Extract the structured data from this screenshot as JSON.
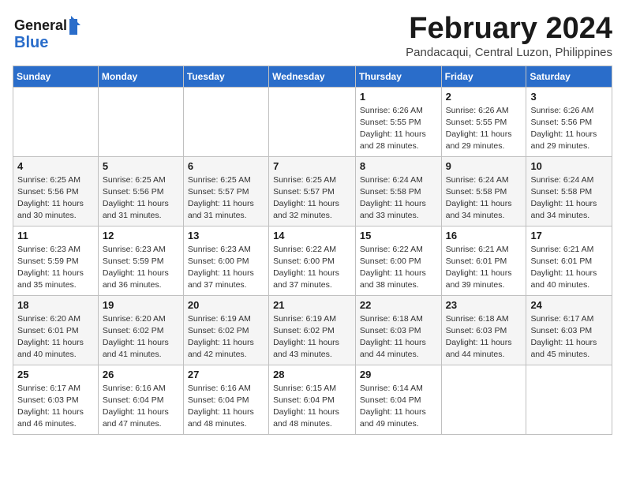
{
  "header": {
    "logo_line1": "General",
    "logo_line2": "Blue",
    "title": "February 2024",
    "subtitle": "Pandacaqui, Central Luzon, Philippines"
  },
  "weekdays": [
    "Sunday",
    "Monday",
    "Tuesday",
    "Wednesday",
    "Thursday",
    "Friday",
    "Saturday"
  ],
  "weeks": [
    [
      {
        "day": "",
        "info": ""
      },
      {
        "day": "",
        "info": ""
      },
      {
        "day": "",
        "info": ""
      },
      {
        "day": "",
        "info": ""
      },
      {
        "day": "1",
        "info": "Sunrise: 6:26 AM\nSunset: 5:55 PM\nDaylight: 11 hours\nand 28 minutes."
      },
      {
        "day": "2",
        "info": "Sunrise: 6:26 AM\nSunset: 5:55 PM\nDaylight: 11 hours\nand 29 minutes."
      },
      {
        "day": "3",
        "info": "Sunrise: 6:26 AM\nSunset: 5:56 PM\nDaylight: 11 hours\nand 29 minutes."
      }
    ],
    [
      {
        "day": "4",
        "info": "Sunrise: 6:25 AM\nSunset: 5:56 PM\nDaylight: 11 hours\nand 30 minutes."
      },
      {
        "day": "5",
        "info": "Sunrise: 6:25 AM\nSunset: 5:56 PM\nDaylight: 11 hours\nand 31 minutes."
      },
      {
        "day": "6",
        "info": "Sunrise: 6:25 AM\nSunset: 5:57 PM\nDaylight: 11 hours\nand 31 minutes."
      },
      {
        "day": "7",
        "info": "Sunrise: 6:25 AM\nSunset: 5:57 PM\nDaylight: 11 hours\nand 32 minutes."
      },
      {
        "day": "8",
        "info": "Sunrise: 6:24 AM\nSunset: 5:58 PM\nDaylight: 11 hours\nand 33 minutes."
      },
      {
        "day": "9",
        "info": "Sunrise: 6:24 AM\nSunset: 5:58 PM\nDaylight: 11 hours\nand 34 minutes."
      },
      {
        "day": "10",
        "info": "Sunrise: 6:24 AM\nSunset: 5:58 PM\nDaylight: 11 hours\nand 34 minutes."
      }
    ],
    [
      {
        "day": "11",
        "info": "Sunrise: 6:23 AM\nSunset: 5:59 PM\nDaylight: 11 hours\nand 35 minutes."
      },
      {
        "day": "12",
        "info": "Sunrise: 6:23 AM\nSunset: 5:59 PM\nDaylight: 11 hours\nand 36 minutes."
      },
      {
        "day": "13",
        "info": "Sunrise: 6:23 AM\nSunset: 6:00 PM\nDaylight: 11 hours\nand 37 minutes."
      },
      {
        "day": "14",
        "info": "Sunrise: 6:22 AM\nSunset: 6:00 PM\nDaylight: 11 hours\nand 37 minutes."
      },
      {
        "day": "15",
        "info": "Sunrise: 6:22 AM\nSunset: 6:00 PM\nDaylight: 11 hours\nand 38 minutes."
      },
      {
        "day": "16",
        "info": "Sunrise: 6:21 AM\nSunset: 6:01 PM\nDaylight: 11 hours\nand 39 minutes."
      },
      {
        "day": "17",
        "info": "Sunrise: 6:21 AM\nSunset: 6:01 PM\nDaylight: 11 hours\nand 40 minutes."
      }
    ],
    [
      {
        "day": "18",
        "info": "Sunrise: 6:20 AM\nSunset: 6:01 PM\nDaylight: 11 hours\nand 40 minutes."
      },
      {
        "day": "19",
        "info": "Sunrise: 6:20 AM\nSunset: 6:02 PM\nDaylight: 11 hours\nand 41 minutes."
      },
      {
        "day": "20",
        "info": "Sunrise: 6:19 AM\nSunset: 6:02 PM\nDaylight: 11 hours\nand 42 minutes."
      },
      {
        "day": "21",
        "info": "Sunrise: 6:19 AM\nSunset: 6:02 PM\nDaylight: 11 hours\nand 43 minutes."
      },
      {
        "day": "22",
        "info": "Sunrise: 6:18 AM\nSunset: 6:03 PM\nDaylight: 11 hours\nand 44 minutes."
      },
      {
        "day": "23",
        "info": "Sunrise: 6:18 AM\nSunset: 6:03 PM\nDaylight: 11 hours\nand 44 minutes."
      },
      {
        "day": "24",
        "info": "Sunrise: 6:17 AM\nSunset: 6:03 PM\nDaylight: 11 hours\nand 45 minutes."
      }
    ],
    [
      {
        "day": "25",
        "info": "Sunrise: 6:17 AM\nSunset: 6:03 PM\nDaylight: 11 hours\nand 46 minutes."
      },
      {
        "day": "26",
        "info": "Sunrise: 6:16 AM\nSunset: 6:04 PM\nDaylight: 11 hours\nand 47 minutes."
      },
      {
        "day": "27",
        "info": "Sunrise: 6:16 AM\nSunset: 6:04 PM\nDaylight: 11 hours\nand 48 minutes."
      },
      {
        "day": "28",
        "info": "Sunrise: 6:15 AM\nSunset: 6:04 PM\nDaylight: 11 hours\nand 48 minutes."
      },
      {
        "day": "29",
        "info": "Sunrise: 6:14 AM\nSunset: 6:04 PM\nDaylight: 11 hours\nand 49 minutes."
      },
      {
        "day": "",
        "info": ""
      },
      {
        "day": "",
        "info": ""
      }
    ]
  ]
}
